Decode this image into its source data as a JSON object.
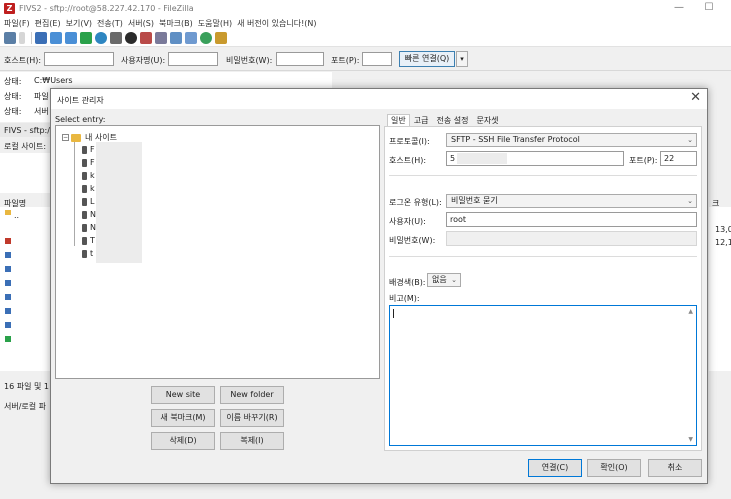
{
  "window": {
    "title": "FIVS2 - sftp://root@58.227.42.170 - FileZilla",
    "app_icon_letter": "Z",
    "minimize": "—",
    "maximize": "☐"
  },
  "menu": [
    "파일(F)",
    "편집(E)",
    "보기(V)",
    "전송(T)",
    "서버(S)",
    "북마크(B)",
    "도움말(H)",
    "새 버전이 있습니다!(N)"
  ],
  "quickconnect": {
    "host_label": "호스트(H):",
    "user_label": "사용자명(U):",
    "password_label": "비밀번호(W):",
    "port_label": "포트(P):",
    "connect_button": "빠른 연결(Q)",
    "dropdown": "▾"
  },
  "log": [
    {
      "label": "상태:",
      "text": "C:₩Users"
    },
    {
      "label": "상태:",
      "text": "파일"
    },
    {
      "label": "상태:",
      "text": "서버"
    }
  ],
  "background": {
    "tab_label": "FIVS - sftp:/",
    "local_site_label": "로컬 사이트:",
    "filename_header": "파일명",
    "parent_dir": "..",
    "status_left": "16 파일 및 1",
    "queue_label": "서버/로컬 파",
    "right_col_1": "13,0",
    "right_col_2": "12,1",
    "right_header": "크"
  },
  "site_manager": {
    "title": "사이트 관리자",
    "close": "✕",
    "select_entry_label": "Select entry:",
    "tree": {
      "root_label": "내 사이트",
      "expand": "−",
      "items": [
        "F",
        "F",
        "k",
        "k",
        "L",
        "N",
        "N",
        "T",
        "t"
      ]
    },
    "buttons": {
      "new_site": "New site",
      "new_folder": "New folder",
      "new_bookmark": "새 북마크(M)",
      "rename": "이름 바꾸기(R)",
      "delete": "삭제(D)",
      "duplicate": "복제(I)"
    },
    "tabs": [
      "일반",
      "고급",
      "전송 설정",
      "문자셋"
    ],
    "general": {
      "protocol_label": "프로토콜(I):",
      "protocol_value": "SFTP - SSH File Transfer Protocol",
      "host_label": "호스트(H):",
      "host_value": "5",
      "port_label": "포트(P):",
      "port_value": "22",
      "logon_type_label": "로그온 유형(L):",
      "logon_type_value": "비밀번호 묻기",
      "user_label": "사용자(U):",
      "user_value": "root",
      "password_label": "비밀번호(W):",
      "bg_color_label": "배경색(B):",
      "bg_color_value": "없음",
      "comments_label": "비고(M):"
    },
    "footer": {
      "connect": "연결(C)",
      "ok": "확인(O)",
      "cancel": "취소"
    }
  }
}
